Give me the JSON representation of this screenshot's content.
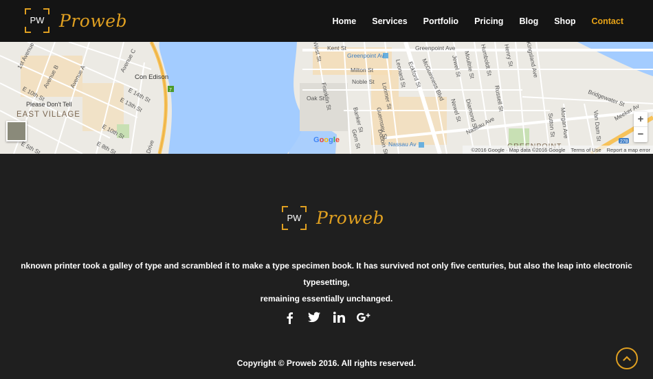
{
  "header": {
    "logo_initials": "PW",
    "logo_name": "Proweb",
    "nav": [
      {
        "label": "Home",
        "active": false
      },
      {
        "label": "Services",
        "active": false
      },
      {
        "label": "Portfolio",
        "active": false
      },
      {
        "label": "Pricing",
        "active": false
      },
      {
        "label": "Blog",
        "active": false
      },
      {
        "label": "Shop",
        "active": false
      },
      {
        "label": "Contact",
        "active": true
      }
    ]
  },
  "map": {
    "labels": {
      "east_village": "EAST VILLAGE",
      "greenpoint": "GREENPOINT",
      "con_edison": "Con Edison",
      "please_dont_tell": "Please Don't Tell",
      "greenpoint_av_station": "Greenpoint Av",
      "nassau_av_station": "Nassau Av",
      "kent_st": "Kent St",
      "milton_st": "Milton St",
      "noble_st": "Noble St",
      "oak_st": "Oak St",
      "greenpoint_ave": "Greenpoint Ave",
      "nassau_ave": "Nassau Ave",
      "bridgewater_st": "Bridgewater St",
      "meeker_av": "Meeker Av",
      "avenue_a": "Avenue A",
      "avenue_b": "Avenue B",
      "avenue_c": "Avenue C",
      "first_avenue": "1st Avenue",
      "e_10th_st": "E 10th St",
      "e_14th_st": "E 14th St",
      "e_13th_st": "E 13th St",
      "e_10th_st_b": "E 10th St",
      "e_5th_st": "E 5th St",
      "e_8th_st": "E 8th St",
      "drive": "Drive",
      "franklin_st": "Franklin St",
      "west_st": "West St",
      "lorimer_st": "Lorimer St",
      "guernsey_st": "Guernsey St",
      "eckford_st": "Eckford St",
      "leonard_st": "Leonard St",
      "mcguinness_blvd": "McGuinness Blvd",
      "jewel_st": "Jewel St",
      "moultrie_st": "Moultrie St",
      "humboldt_st": "Humboldt St",
      "henry_st": "Henry St",
      "kingsland_ave": "Kingsland Ave",
      "newel_st": "Newel St",
      "diamond_st": "Diamond St",
      "russell_st": "Russell St",
      "banker_st": "Banker St",
      "gem_st": "Gem St",
      "dobbin_st": "Dobbin St",
      "sutton_st": "Sutton St",
      "morgan_ave": "Morgan Ave",
      "van_dam_st": "Van Dam St",
      "route_278": "278",
      "route_7": "7"
    },
    "google": [
      "G",
      "o",
      "o",
      "g",
      "l",
      "e"
    ],
    "attribution": "©2016 Google · Map data ©2016 Google",
    "terms": "Terms of Use",
    "report": "Report a map error",
    "zoom_in": "+",
    "zoom_out": "−"
  },
  "footer": {
    "logo_initials": "PW",
    "logo_name": "Proweb",
    "text": "nknown printer took a galley of type and scrambled it to make a type specimen book. It has survived not only five centuries, but also the leap into electronic typesetting,\nremaining essentially unchanged.",
    "social": [
      {
        "icon": "facebook-icon",
        "glyph": "f"
      },
      {
        "icon": "twitter-icon",
        "glyph": "t"
      },
      {
        "icon": "linkedin-icon",
        "glyph": "in"
      },
      {
        "icon": "google-plus-icon",
        "glyph": "g+"
      }
    ],
    "copyright": "Copyright © Proweb 2016. All rights reserved."
  },
  "colors": {
    "accent": "#e0a021",
    "header_bg": "#141414",
    "footer_bg": "#1f1f1f",
    "water": "#a3ccff"
  }
}
